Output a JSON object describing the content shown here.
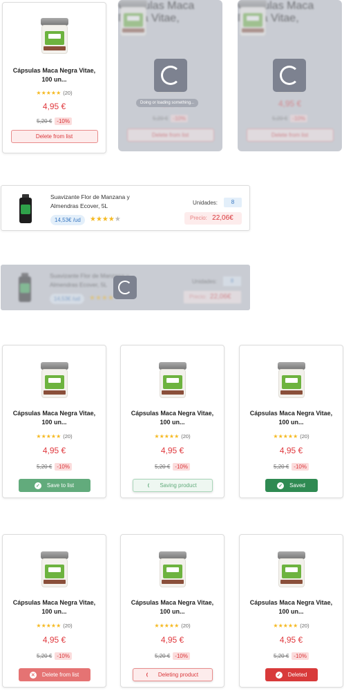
{
  "product": {
    "title_line1": "Cápsulas Maca Negra Vitae,",
    "title_line2": "100 un...",
    "stars": "★★★★★",
    "reviews": "(20)",
    "price": "4,95 €",
    "old_price": "5,20 €",
    "discount": "-10%"
  },
  "loading": {
    "message": "Doing or loading something..."
  },
  "list_item": {
    "name_line1": "Suavizante Flor de Manzana y",
    "name_line2": "Almendras Ecover, 5L",
    "unit_price": "14,53€ /ud",
    "stars": "★★★★",
    "star_empty": "★",
    "units_label": "Unidades:",
    "units_value": "8",
    "price_label": "Precio:",
    "price_value": "22,06€"
  },
  "buttons": {
    "delete_from_list": "Delete from list",
    "save_to_list": "Save to list",
    "saving_product": "Saving product",
    "saved": "Saved",
    "deleting_product": "Deleting product",
    "deleted": "Deleted"
  },
  "colors": {
    "accent_red": "#e0393e",
    "save_green": "#62ab7c",
    "saved_green": "#2f8a52",
    "deleted_red": "#d83a3a"
  }
}
